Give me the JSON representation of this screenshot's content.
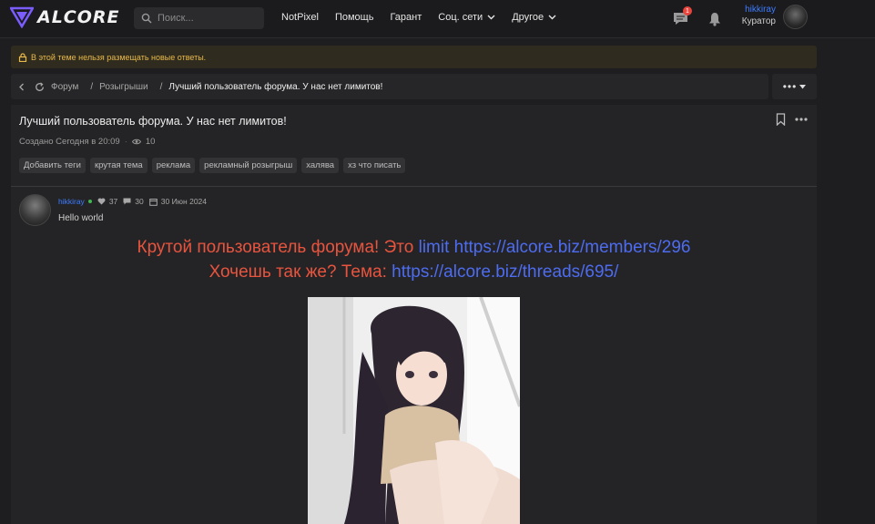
{
  "header": {
    "logo_text": "ALCORE",
    "search_placeholder": "Поиск...",
    "nav": [
      {
        "label": "NotPixel",
        "dropdown": false
      },
      {
        "label": "Помощь",
        "dropdown": false
      },
      {
        "label": "Гарант",
        "dropdown": false
      },
      {
        "label": "Соц. сети",
        "dropdown": true
      },
      {
        "label": "Другое",
        "dropdown": true
      }
    ],
    "messages_badge": "1",
    "user": {
      "name": "hikkiray",
      "role": "Куратор"
    }
  },
  "notice": {
    "text": "В этой теме нельзя размещать новые ответы."
  },
  "breadcrumb": {
    "items": [
      "Форум",
      "Розыгрыши"
    ],
    "current": "Лучший пользователь форума. У нас нет лимитов!",
    "more_label": "•••"
  },
  "thread": {
    "title": "Лучший пользователь форума. У нас нет лимитов!",
    "created": "Создано Сегодня в 20:09",
    "views": "10",
    "tags": [
      "Добавить теги",
      "крутая тема",
      "реклама",
      "рекламный розыгрыш",
      "халява",
      "хз что писать"
    ]
  },
  "post": {
    "author": "hikkiray",
    "likes": "37",
    "messages": "30",
    "date": "30 Июн 2024",
    "text": "Hello world",
    "line1": {
      "red": "Крутой пользователь форума! Это ",
      "link1": "limit",
      "link2": " https://alcore.biz/members/296"
    },
    "line2": {
      "red": "Хочешь так же? Тема: ",
      "link": "https://alcore.biz/threads/695/"
    }
  },
  "colors": {
    "accent_blue": "#3d7cff",
    "promo_red": "#e8543e",
    "promo_blue": "#4d6cf0",
    "notice_yellow": "#e8b949"
  }
}
